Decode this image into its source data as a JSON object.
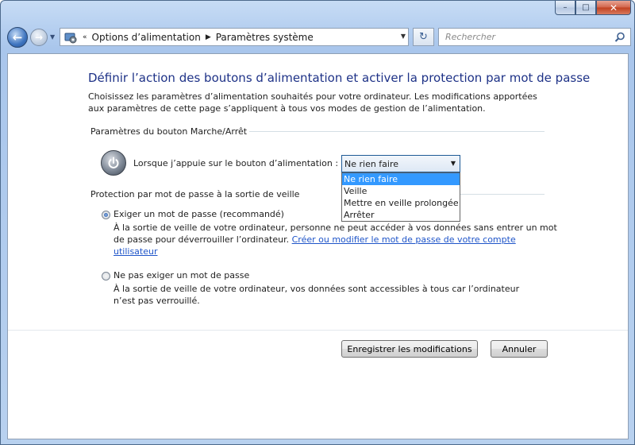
{
  "window": {
    "caption_minimize": "–",
    "caption_maximize": "□",
    "caption_close": "✕"
  },
  "nav": {
    "back_glyph": "←",
    "forward_glyph": "→",
    "recent_glyph": "▼",
    "overflow": "«",
    "separator": "▶",
    "breadcrumbs": [
      "Options d’alimentation",
      "Paramètres système"
    ],
    "address_dropdown": "▼",
    "refresh_glyph": "↻",
    "search_placeholder": "Rechercher"
  },
  "page": {
    "title": "Définir l’action des boutons d’alimentation et activer la protection par mot de passe",
    "intro": "Choisissez les paramètres d’alimentation souhaités pour votre ordinateur. Les modifications apportées aux paramètres de cette page s’appliquent à tous vos modes de gestion de l’alimentation."
  },
  "power_section": {
    "title": "Paramètres du bouton Marche/Arrêt",
    "label": "Lorsque j’appuie sur le bouton d’alimentation :",
    "selected": "Ne rien faire",
    "arrow": "▼",
    "options": [
      "Ne rien faire",
      "Veille",
      "Mettre en veille prolongée",
      "Arrêter"
    ]
  },
  "password_section": {
    "title": "Protection par mot de passe à la sortie de veille",
    "option1_label": "Exiger un mot de passe (recommandé)",
    "option1_desc": "À la sortie de veille de votre ordinateur, personne ne peut accéder à vos données sans entrer un mot de passe pour déverrouiller l’ordinateur.",
    "option1_link": "Créer ou modifier le mot de passe de votre compte utilisateur",
    "option1_checked": true,
    "option2_label": "Ne pas exiger un mot de passe",
    "option2_desc": "À la sortie de veille de votre ordinateur, vos données sont accessibles à tous car l’ordinateur n’est pas verrouillé.",
    "option2_checked": false
  },
  "buttons": {
    "save": "Enregistrer les modifications",
    "cancel": "Annuler"
  },
  "colors": {
    "title": "#1e3287",
    "link": "#1f55c9",
    "selection": "#3399ff"
  },
  "icons": [
    "folder-back-icon",
    "control-panel-icon",
    "refresh-icon",
    "search-icon",
    "power-icon"
  ]
}
